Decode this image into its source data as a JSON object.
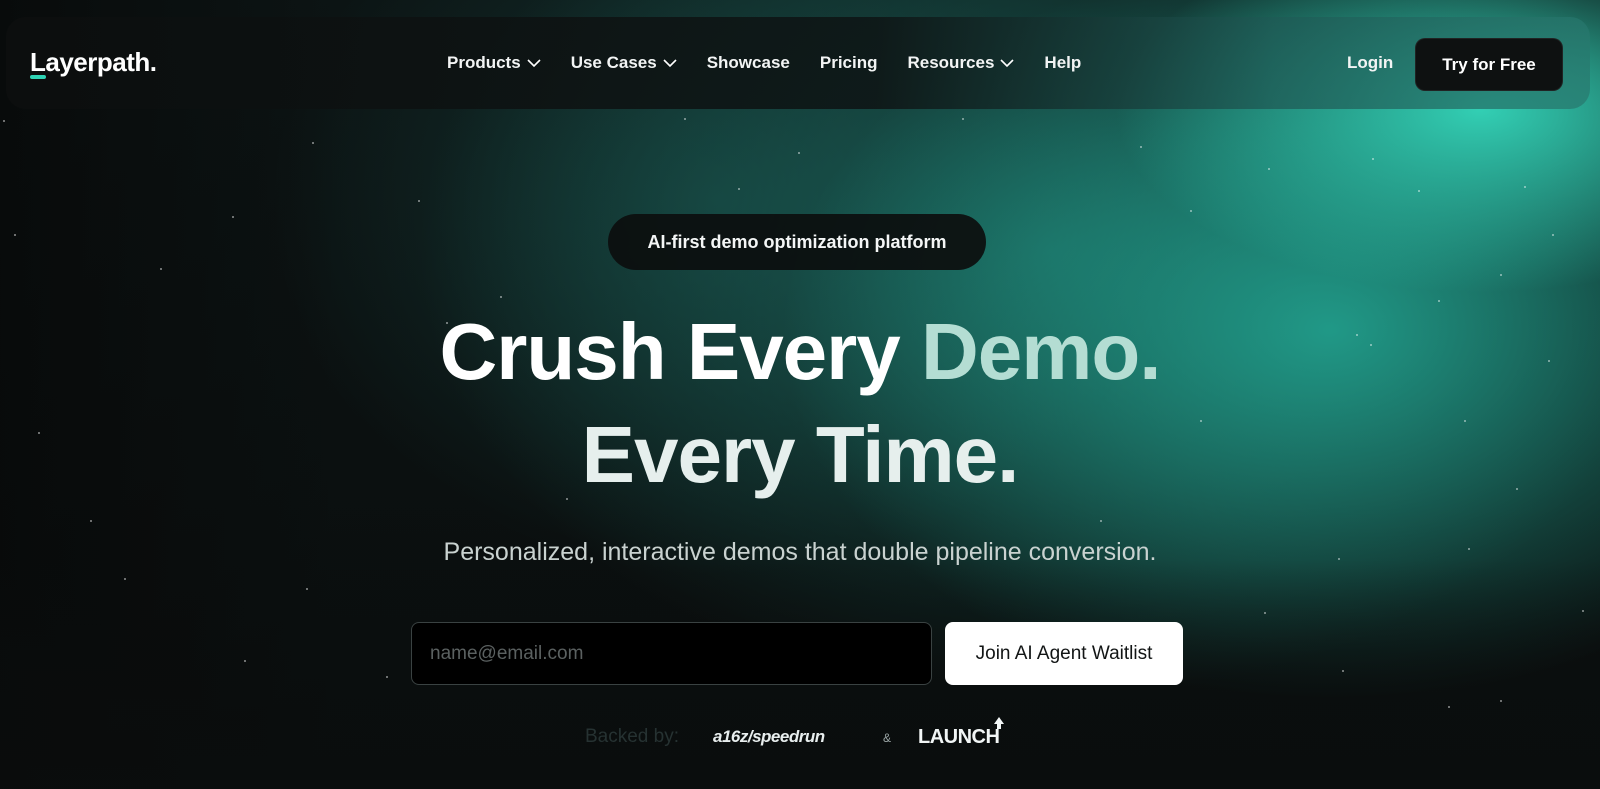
{
  "brand": {
    "name": "Layerpath."
  },
  "nav": {
    "items": [
      {
        "label": "Products",
        "has_dropdown": true
      },
      {
        "label": "Use Cases",
        "has_dropdown": true
      },
      {
        "label": "Showcase",
        "has_dropdown": false
      },
      {
        "label": "Pricing",
        "has_dropdown": false
      },
      {
        "label": "Resources",
        "has_dropdown": true
      },
      {
        "label": "Help",
        "has_dropdown": false
      }
    ],
    "login_label": "Login",
    "cta_label": "Try for Free"
  },
  "hero": {
    "pill": "AI-first demo optimization platform",
    "headline_line1_a": "Crush Every ",
    "headline_line1_b": "Demo.",
    "headline_line2": "Every Time.",
    "subtitle": "Personalized, interactive demos that double pipeline conversion.",
    "email_placeholder": "name@email.com",
    "email_value": "",
    "submit_label": "Join AI Agent Waitlist"
  },
  "backers": {
    "label": "Backed by:",
    "first": "a16z/speedrun",
    "separator": "&",
    "second": "LAUNCH"
  },
  "colors": {
    "accent": "#2fd3b4",
    "background": "#0a0d0d",
    "button_dark": "#0e1111"
  }
}
